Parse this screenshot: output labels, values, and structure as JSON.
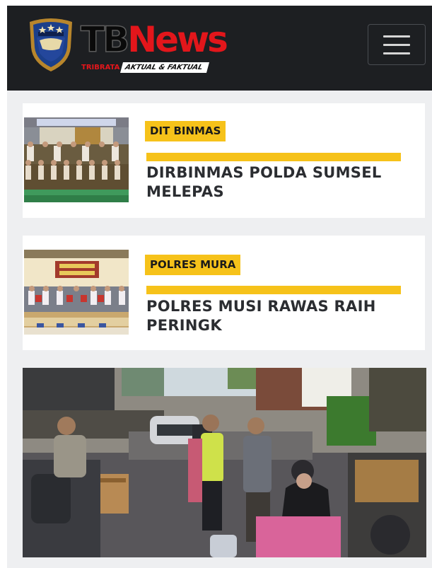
{
  "header": {
    "brand_tb": "TB",
    "brand_news": "News",
    "tagline_left": "TRIBRATA",
    "tagline_right": "AKTUAL & FAKTUAL",
    "menu_icon": "hamburger-menu-icon"
  },
  "articles": [
    {
      "category": "DIT BINMAS",
      "title": "DIRBINMAS POLDA SUMSEL MELEPAS"
    },
    {
      "category": "POLRES MURA",
      "title": "POLRES MUSI RAWAS RAIH PERINGK"
    }
  ],
  "colors": {
    "header_bg": "#1d1f22",
    "brand_red": "#e3161b",
    "category_yellow": "#f6c21a",
    "page_bg": "#eeeff1",
    "title_text": "#2b2d31"
  }
}
